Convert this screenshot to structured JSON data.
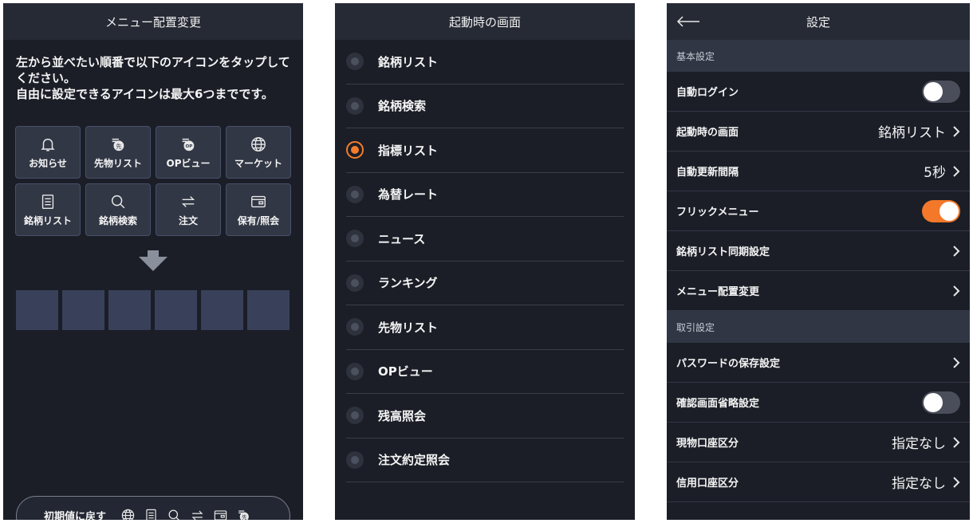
{
  "menu_screen": {
    "title": "メニュー配置変更",
    "instructions": [
      "左から並べたい順番で以下のアイコンをタップして",
      "ください。",
      "自由に設定できるアイコンは最大6つまでです。"
    ],
    "icons": [
      {
        "label": "お知らせ",
        "icon": "bell-icon"
      },
      {
        "label": "先物リスト",
        "icon": "futures-icon"
      },
      {
        "label": "OPビュー",
        "icon": "option-icon"
      },
      {
        "label": "マーケット",
        "icon": "globe-icon"
      },
      {
        "label": "銘柄リスト",
        "icon": "list-icon"
      },
      {
        "label": "銘柄検索",
        "icon": "search-icon"
      },
      {
        "label": "注文",
        "icon": "swap-icon"
      },
      {
        "label": "保有/照会",
        "icon": "wallet-icon"
      }
    ],
    "slot_count": 6,
    "reset_label": "初期値に戻す",
    "selected_icons": [
      "globe-icon",
      "list-icon",
      "search-icon",
      "swap-icon",
      "wallet-icon",
      "futures-icon"
    ]
  },
  "startup_screen": {
    "title": "起動時の画面",
    "options": [
      "銘柄リスト",
      "銘柄検索",
      "指標リスト",
      "為替レート",
      "ニュース",
      "ランキング",
      "先物リスト",
      "OPビュー",
      "残高照会",
      "注文約定照会"
    ],
    "selected_index": 2
  },
  "settings_screen": {
    "title": "設定",
    "sections": [
      {
        "header": "基本設定",
        "rows": [
          {
            "label": "自動ログイン",
            "type": "toggle",
            "on": false
          },
          {
            "label": "起動時の画面",
            "type": "value",
            "value": "銘柄リスト"
          },
          {
            "label": "自動更新間隔",
            "type": "value",
            "value": "5秒"
          },
          {
            "label": "フリックメニュー",
            "type": "toggle",
            "on": true
          },
          {
            "label": "銘柄リスト同期設定",
            "type": "link"
          },
          {
            "label": "メニュー配置変更",
            "type": "link"
          }
        ]
      },
      {
        "header": "取引設定",
        "rows": [
          {
            "label": "パスワードの保存設定",
            "type": "link"
          },
          {
            "label": "確認画面省略設定",
            "type": "toggle",
            "on": false
          },
          {
            "label": "現物口座区分",
            "type": "value",
            "value": "指定なし"
          },
          {
            "label": "信用口座区分",
            "type": "value",
            "value": "指定なし"
          }
        ]
      }
    ]
  },
  "colors": {
    "accent": "#f47d2c",
    "background": "#1b1e27",
    "header": "#262a35"
  }
}
